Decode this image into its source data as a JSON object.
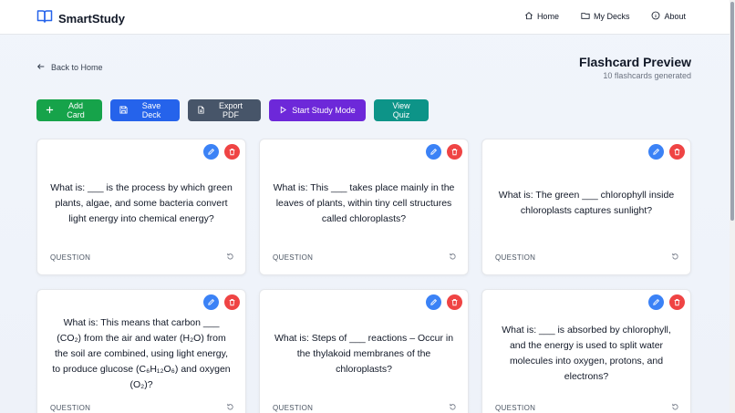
{
  "header": {
    "brand": "SmartStudy",
    "nav": [
      {
        "label": "Home",
        "icon": "home-icon"
      },
      {
        "label": "My Decks",
        "icon": "folder-icon"
      },
      {
        "label": "About",
        "icon": "info-icon"
      }
    ]
  },
  "back_label": "Back to Home",
  "page": {
    "title": "Flashcard Preview",
    "subtitle": "10 flashcards generated"
  },
  "actions": {
    "add": "Add Card",
    "save": "Save Deck",
    "export": "Export PDF",
    "study": "Start Study Mode",
    "quiz": "View Quiz"
  },
  "colors": {
    "add": "#16a34a",
    "save": "#2563eb",
    "export": "#475569",
    "study": "#6d28d9",
    "quiz": "#0d9488",
    "edit": "#3b82f6",
    "delete": "#ef4444"
  },
  "cards": [
    {
      "text": "What is: ___ is the process by which green plants, algae, and some bacteria convert light energy into chemical energy?",
      "label": "QUESTION"
    },
    {
      "text": "What is: This ___ takes place mainly in the leaves of plants, within tiny cell structures called chloroplasts?",
      "label": "QUESTION"
    },
    {
      "text": "What is: The green ___ chlorophyll inside chloroplasts captures sunlight?",
      "label": "QUESTION"
    },
    {
      "text": "What is: This means that carbon ___ (CO₂) from the air and water (H₂O) from the soil are combined, using light energy, to produce glucose (C₆H₁₂O₆) and oxygen (O₂)?",
      "label": "QUESTION"
    },
    {
      "text": "What is: Steps of ___ reactions – Occur in the thylakoid membranes of the chloroplasts?",
      "label": "QUESTION"
    },
    {
      "text": "What is: ___ is absorbed by chlorophyll, and the energy is used to split water molecules into oxygen, protons, and electrons?",
      "label": "QUESTION"
    }
  ]
}
